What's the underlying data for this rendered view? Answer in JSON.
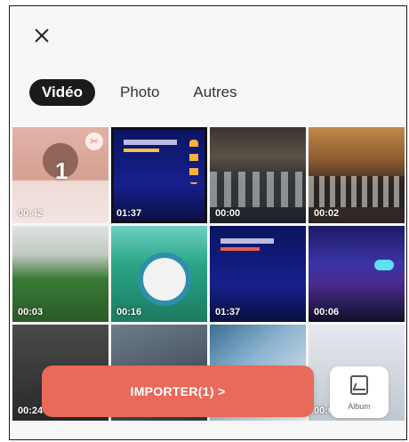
{
  "header": {
    "close_icon": "close-icon",
    "tabs": [
      {
        "label": "Vidéo",
        "active": true
      },
      {
        "label": "Photo",
        "active": false
      },
      {
        "label": "Autres",
        "active": false
      }
    ]
  },
  "grid": {
    "items": [
      {
        "duration": "00:42",
        "order": "1",
        "selected": true
      },
      {
        "duration": "01:37",
        "selected": false
      },
      {
        "duration": "00:00",
        "selected": false
      },
      {
        "duration": "00:02",
        "selected": false
      },
      {
        "duration": "00:03",
        "selected": false
      },
      {
        "duration": "00:16",
        "selected": false
      },
      {
        "duration": "01:37",
        "selected": false
      },
      {
        "duration": "00:06",
        "selected": false
      },
      {
        "duration": "00:24",
        "selected": false
      },
      {
        "duration": "",
        "selected": false
      },
      {
        "duration": "",
        "selected": false
      },
      {
        "duration": "00:00",
        "selected": false
      }
    ]
  },
  "footer": {
    "import_label": "IMPORTER(1) >",
    "album_label": "Album",
    "accent_color": "#e9695a"
  }
}
